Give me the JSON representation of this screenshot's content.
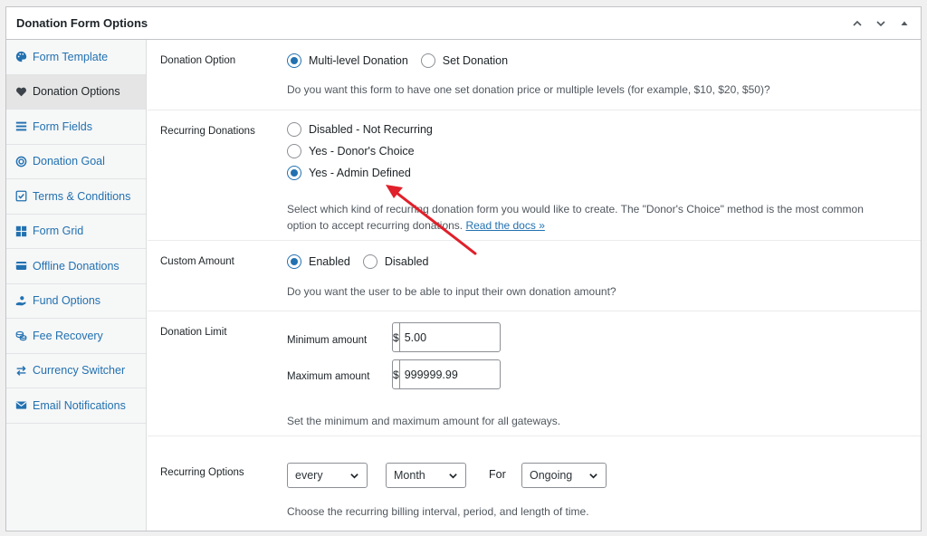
{
  "header": {
    "title": "Donation Form Options"
  },
  "sidebar": {
    "items": [
      {
        "label": "Form Template",
        "icon": "palette-icon"
      },
      {
        "label": "Donation Options",
        "icon": "heart-icon",
        "active": true
      },
      {
        "label": "Form Fields",
        "icon": "list-icon"
      },
      {
        "label": "Donation Goal",
        "icon": "target-icon"
      },
      {
        "label": "Terms & Conditions",
        "icon": "checkbox-icon"
      },
      {
        "label": "Form Grid",
        "icon": "grid-icon"
      },
      {
        "label": "Offline Donations",
        "icon": "card-icon"
      },
      {
        "label": "Fund Options",
        "icon": "hand-coin-icon"
      },
      {
        "label": "Fee Recovery",
        "icon": "coins-icon"
      },
      {
        "label": "Currency Switcher",
        "icon": "swap-icon"
      },
      {
        "label": "Email Notifications",
        "icon": "envelope-icon"
      }
    ]
  },
  "donation_option": {
    "label": "Donation Option",
    "options": [
      "Multi-level Donation",
      "Set Donation"
    ],
    "selected": "Multi-level Donation",
    "description": "Do you want this form to have one set donation price or multiple levels (for example, $10, $20, $50)?"
  },
  "recurring_donations": {
    "label": "Recurring Donations",
    "options": [
      "Disabled - Not Recurring",
      "Yes - Donor's Choice",
      "Yes - Admin Defined"
    ],
    "selected": "Yes - Admin Defined",
    "description_line1": "Select which kind of recurring donation form you would like to create. The \"Donor's Choice\" method is the most common",
    "description_line2": "option to accept recurring donations. ",
    "docs_link": "Read the docs »"
  },
  "custom_amount": {
    "label": "Custom Amount",
    "options": [
      "Enabled",
      "Disabled"
    ],
    "selected": "Enabled",
    "description": "Do you want the user to be able to input their own donation amount?"
  },
  "donation_limit": {
    "label": "Donation Limit",
    "minimum_label": "Minimum amount",
    "maximum_label": "Maximum amount",
    "currency_symbol": "$",
    "minimum_value": "5.00",
    "maximum_value": "999999.99",
    "description": "Set the minimum and maximum amount for all gateways."
  },
  "recurring_options": {
    "label": "Recurring Options",
    "interval": "every",
    "period": "Month",
    "for_label": "For",
    "length": "Ongoing",
    "description": "Choose the recurring billing interval, period, and length of time."
  },
  "colors": {
    "accent": "#2271b1",
    "annotation_arrow": "#e0202a"
  }
}
